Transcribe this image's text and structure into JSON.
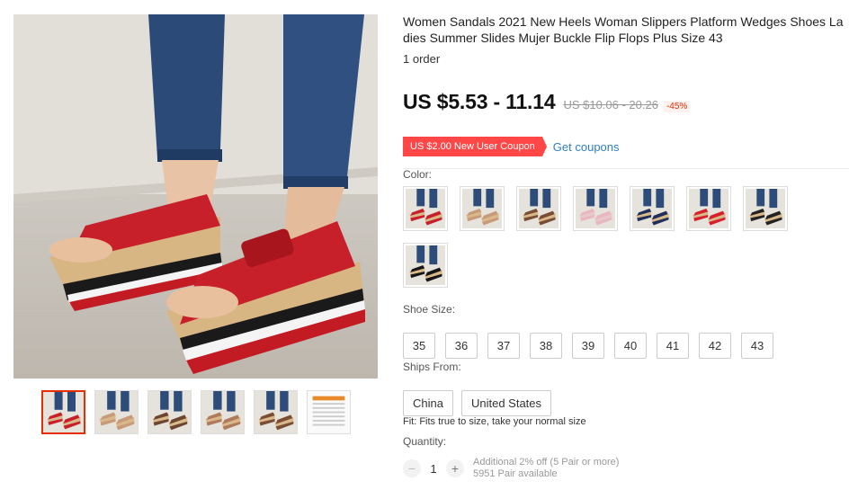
{
  "product": {
    "title": "Women Sandals 2021 New Heels Woman Slippers Platform Wedges Shoes Ladies Summer Slides Mujer Buckle Flip Flops Plus Size 43",
    "orders": "1 order",
    "price": "US $5.53 - 11.14",
    "original_price": "US $10.06 - 20.26",
    "discount": "-45%"
  },
  "coupon": {
    "label": "US $2.00 New User Coupon",
    "link": "Get coupons"
  },
  "color": {
    "label": "Color:",
    "swatches": [
      {
        "name": "red-wedge",
        "strap": "#c8202a",
        "sole": "#d9b98a"
      },
      {
        "name": "beige-wedge",
        "strap": "#c79b7a",
        "sole": "#d9b98a"
      },
      {
        "name": "brown-wedge",
        "strap": "#7a4e34",
        "sole": "#d9b98a"
      },
      {
        "name": "pink-wedge",
        "strap": "#e8b7bf",
        "sole": "#e7c9c9"
      },
      {
        "name": "navy-wedge",
        "strap": "#1f2f5a",
        "sole": "#d9b98a"
      },
      {
        "name": "red-side",
        "strap": "#d6202b",
        "sole": "#d9b98a"
      },
      {
        "name": "black-wedge",
        "strap": "#222222",
        "sole": "#d9b98a"
      },
      {
        "name": "black-side",
        "strap": "#161616",
        "sole": "#d9b98a"
      }
    ]
  },
  "shoe_size": {
    "label": "Shoe Size:",
    "options": [
      "35",
      "36",
      "37",
      "38",
      "39",
      "40",
      "41",
      "42",
      "43"
    ]
  },
  "ships_from": {
    "label": "Ships From:",
    "options": [
      "China",
      "United States"
    ]
  },
  "fit": "Fit: Fits true to size, take your normal size",
  "quantity": {
    "label": "Quantity:",
    "value": "1",
    "discount_note": "Additional 2% off (5 Pair or more)",
    "available": "5951 Pair available"
  },
  "thumbnails": [
    {
      "name": "thumb-red",
      "strap": "#c8202a"
    },
    {
      "name": "thumb-beige",
      "strap": "#c79b7a"
    },
    {
      "name": "thumb-brown",
      "strap": "#6d4630"
    },
    {
      "name": "thumb-tan",
      "strap": "#b07a5c"
    },
    {
      "name": "thumb-multi",
      "strap": "#7a4e34"
    },
    {
      "name": "thumb-size-chart",
      "strap": "#e88a2a"
    }
  ]
}
